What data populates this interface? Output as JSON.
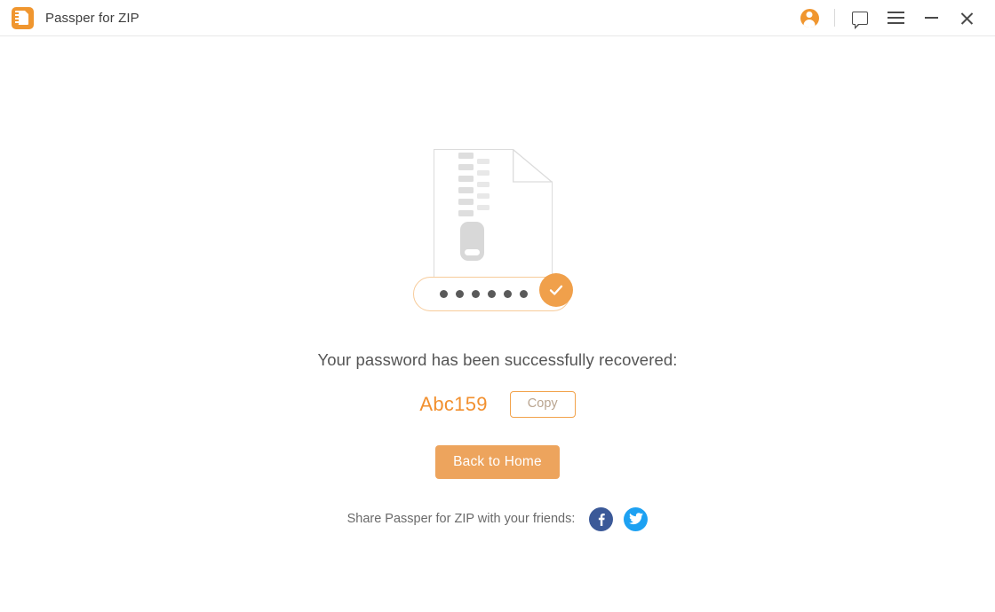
{
  "window": {
    "title": "Passper for ZIP",
    "logo_icon": "zip-file-icon"
  },
  "titlebar": {
    "account_icon": "account-icon",
    "feedback_icon": "speech-bubble-icon",
    "menu_icon": "hamburger-menu-icon",
    "minimize_icon": "minimize-icon",
    "close_icon": "close-icon"
  },
  "illustration": {
    "document_icon": "zip-document-icon",
    "check_icon": "check-mark-icon",
    "password_dots_count": 6
  },
  "main": {
    "headline": "Your password has been successfully recovered:",
    "password": "Abc159",
    "copy_label": "Copy",
    "back_label": "Back to Home"
  },
  "share": {
    "label": "Share Passper for ZIP with your friends:",
    "facebook_icon": "facebook-icon",
    "twitter_icon": "twitter-icon"
  },
  "colors": {
    "accent": "#f0962f",
    "button": "#eda45d",
    "password_text": "#f2902f",
    "pill_border": "#f7cb9a",
    "check_circle": "#f0a04b",
    "facebook": "#3b5998",
    "twitter": "#1da1f2"
  }
}
